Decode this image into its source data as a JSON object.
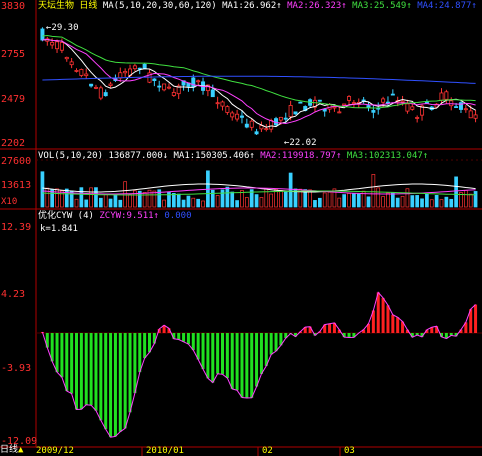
{
  "colors": {
    "bg": "#000000",
    "frame": "#b00000",
    "up": "#ff3333",
    "down": "#39d0ff",
    "ma1": "#ffffff",
    "ma2": "#ff40ff",
    "ma3": "#40e040",
    "ma4": "#3050ff",
    "vol_up": "#ff3333",
    "vol_down": "#39d0ff",
    "ind_pos": "#ff2020",
    "ind_neg": "#20e020",
    "ind_line": "#ff40ff",
    "axis_text": "#ff3030",
    "yellow": "#ffff00"
  },
  "main": {
    "title": "天坛生物 日线",
    "ma_params": "MA(5,10,20,30,60,120)",
    "ma1": {
      "label": "MA1:",
      "value": "26.962↑"
    },
    "ma2": {
      "label": "MA2:",
      "value": "26.323↑"
    },
    "ma3": {
      "label": "MA3:",
      "value": "25.549↑"
    },
    "ma4": {
      "label": "MA4:",
      "value": "24.877↑"
    },
    "y_ticks": [
      "3830",
      "2755",
      "2479",
      "2202"
    ],
    "high_mark": "29.30",
    "low_mark": "22.02"
  },
  "volume": {
    "label": "VOL(5,10,20)",
    "vol": "136877.000↓",
    "ma1": {
      "label": "MA1:",
      "value": "150305.406↑"
    },
    "ma2": {
      "label": "MA2:",
      "value": "119918.797↑"
    },
    "ma3": {
      "label": "MA3:",
      "value": "102313.047↑"
    },
    "y_ticks": [
      "27600",
      "13613"
    ],
    "unit": "X10"
  },
  "indicator": {
    "name": "优化CYW (4)",
    "zcyw_label": "ZCYW:",
    "zcyw_value": "9.511↑",
    "zcyw_extra": "0.000",
    "k_text": "k=1.841",
    "y_ticks": [
      "12.39",
      "4.23",
      "-3.93",
      "-12.09"
    ]
  },
  "x_axis": {
    "left_label": "日线",
    "ticks": [
      "2009/12",
      "2010/01",
      "02",
      "03"
    ]
  }
}
